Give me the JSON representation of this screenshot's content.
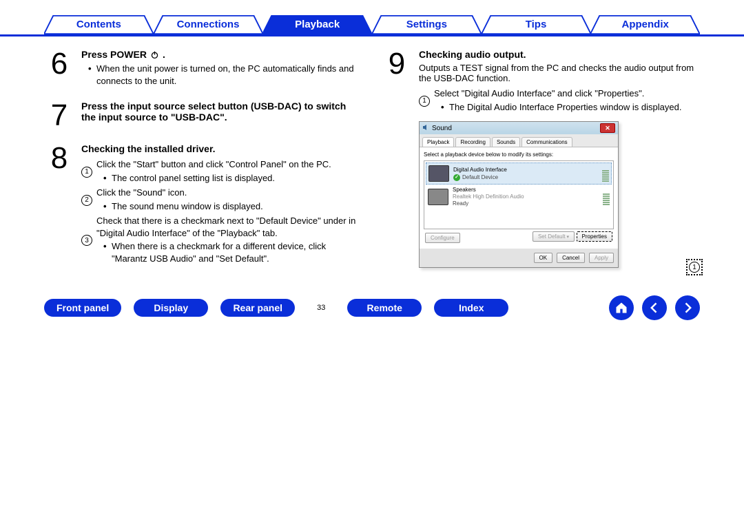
{
  "topTabs": [
    "Contents",
    "Connections",
    "Playback",
    "Settings",
    "Tips",
    "Appendix"
  ],
  "activeTab": 2,
  "step6": {
    "num": "6",
    "title": "Press POWER ",
    "bullets": [
      "When the unit power is turned on, the PC automatically finds and connects to the unit."
    ]
  },
  "step7": {
    "num": "7",
    "title": "Press the input source select button (USB-DAC) to switch the input source to \"USB-DAC\"."
  },
  "step8": {
    "num": "8",
    "title": "Checking the installed driver.",
    "sub1": "Click the \"Start\" button and click \"Control Panel\" on the PC.",
    "sub1b": "The control panel setting list is displayed.",
    "sub2": "Click the \"Sound\" icon.",
    "sub2b": "The sound menu window is displayed.",
    "sub3": "Check that there is a checkmark next to \"Default Device\" under in \"Digital Audio Interface\" of the \"Playback\" tab.",
    "sub3b": "When there is a checkmark for a different device, click \"Marantz USB Audio\" and \"Set Default\"."
  },
  "step9": {
    "num": "9",
    "title": "Checking audio output.",
    "desc": "Outputs a TEST signal from the PC and checks the audio output from the USB-DAC function.",
    "sub1": "Select \"Digital Audio Interface\" and click \"Properties\".",
    "sub1b": "The Digital Audio Interface Properties window is displayed."
  },
  "sound": {
    "title": "Sound",
    "tabs": [
      "Playback",
      "Recording",
      "Sounds",
      "Communications"
    ],
    "hint": "Select a playback device below to modify its settings:",
    "dev1_name": "Digital Audio Interface",
    "dev1_drv": "",
    "dev1_stat": "Default Device",
    "dev2_name": "Speakers",
    "dev2_drv": "Realtek High Definition Audio",
    "dev2_stat": "Ready",
    "btn_configure": "Configure",
    "btn_setdefault": "Set Default",
    "btn_properties": "Properties",
    "btn_ok": "OK",
    "btn_cancel": "Cancel",
    "btn_apply": "Apply"
  },
  "callout": "1",
  "bottomBtns": [
    "Front panel",
    "Display",
    "Rear panel"
  ],
  "pageNum": "33",
  "bottomBtns2": [
    "Remote",
    "Index"
  ]
}
